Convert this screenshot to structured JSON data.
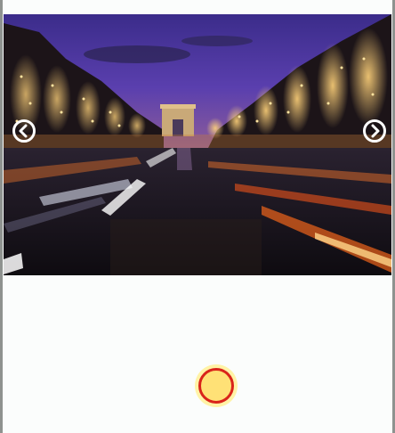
{
  "carousel": {
    "slide_image": "night-avenue-photo",
    "prev_icon": "chevron-left-icon",
    "next_icon": "chevron-right-icon",
    "icon_color": "#ffffff"
  },
  "indicator": {
    "icon": "circle-dot-icon",
    "fill_color": "#ffe176",
    "border_color": "#d9241a",
    "halo_color": "#fff3a6"
  }
}
